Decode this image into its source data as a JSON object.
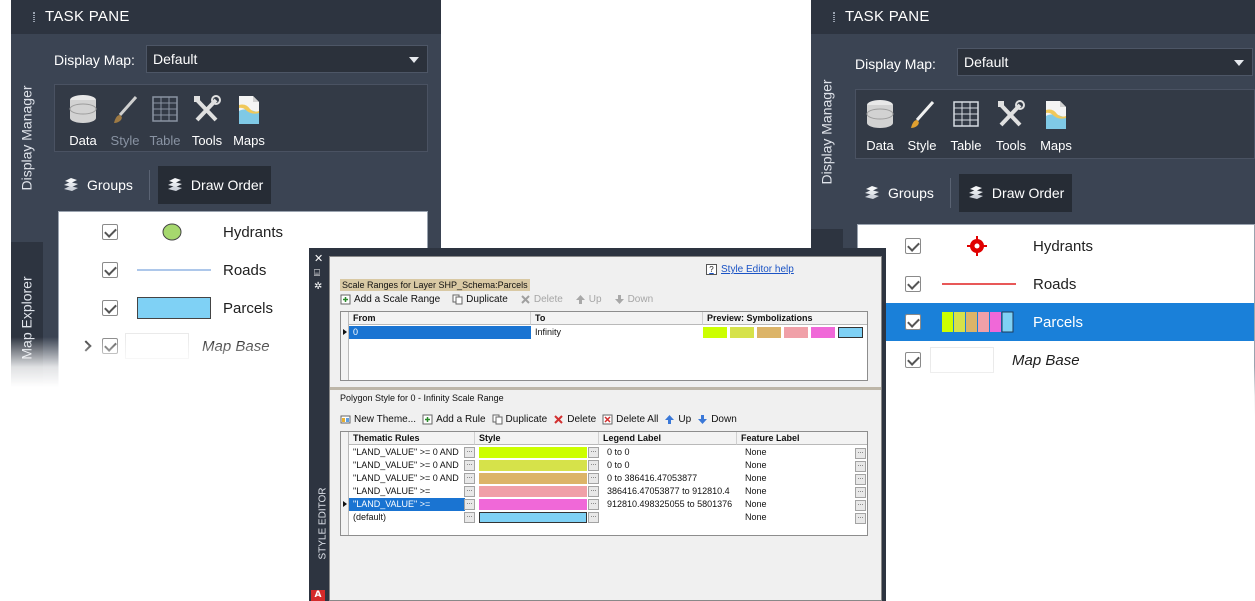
{
  "task_pane": {
    "title": "TASK PANE",
    "tabs": {
      "display_manager": "Display Manager",
      "map_explorer": "Map Explorer"
    },
    "display_map_label": "Display Map:",
    "display_map_value": "Default",
    "tools": [
      {
        "label": "Data",
        "icon": "database-icon"
      },
      {
        "label": "Style",
        "icon": "brush-icon"
      },
      {
        "label": "Table",
        "icon": "table-icon"
      },
      {
        "label": "Tools",
        "icon": "tools-icon"
      },
      {
        "label": "Maps",
        "icon": "maps-icon"
      }
    ],
    "groups_label": "Groups",
    "draw_order_label": "Draw Order"
  },
  "layers": {
    "hydrants": "Hydrants",
    "roads": "Roads",
    "parcels": "Parcels",
    "map_base": "Map Base"
  },
  "colors": {
    "hydrant_left": "#a6d86e",
    "road_left": "#5b8fd6",
    "parcel_left": "#7fd1f5",
    "hydrant_right": "#e00000",
    "road_right": "#e02020",
    "selection": "#1a80d9",
    "theme": [
      "#ccff00",
      "#d6e24a",
      "#dcb468",
      "#f0a0a8",
      "#f068d8",
      "#7fd1f5"
    ]
  },
  "style_editor": {
    "vertical_title": "STYLE EDITOR",
    "help_link": "Style Editor help",
    "scale_ranges_title": "Scale Ranges for Layer SHP_Schema:Parcels",
    "scale_toolbar": {
      "add": "Add a Scale Range",
      "duplicate": "Duplicate",
      "delete": "Delete",
      "up": "Up",
      "down": "Down"
    },
    "scale_headers": {
      "from": "From",
      "to": "To",
      "preview": "Preview: Symbolizations"
    },
    "scale_row": {
      "from": "0",
      "to": "Infinity"
    },
    "polygon_title": "Polygon Style for 0 - Infinity Scale Range",
    "rule_toolbar": {
      "new_theme": "New Theme...",
      "add_rule": "Add a Rule",
      "duplicate": "Duplicate",
      "delete": "Delete",
      "delete_all": "Delete All",
      "up": "Up",
      "down": "Down"
    },
    "rule_headers": {
      "rules": "Thematic Rules",
      "style": "Style",
      "legend": "Legend Label",
      "feature": "Feature Label"
    },
    "rules": [
      {
        "rule": "\"LAND_VALUE\" >= 0 AND",
        "legend": "0 to 0",
        "feature": "None"
      },
      {
        "rule": "\"LAND_VALUE\" >= 0 AND",
        "legend": "0 to 0",
        "feature": "None"
      },
      {
        "rule": "\"LAND_VALUE\" >= 0 AND",
        "legend": "0 to 386416.47053877",
        "feature": "None"
      },
      {
        "rule": "\"LAND_VALUE\" >=",
        "legend": "386416.47053877 to 912810.4",
        "feature": "None"
      },
      {
        "rule": "\"LAND_VALUE\" >=",
        "legend": "912810.498325055 to 5801376",
        "feature": "None"
      },
      {
        "rule": "(default)",
        "legend": "",
        "feature": "None"
      }
    ],
    "dots": "...",
    "logo_letter": "A"
  }
}
